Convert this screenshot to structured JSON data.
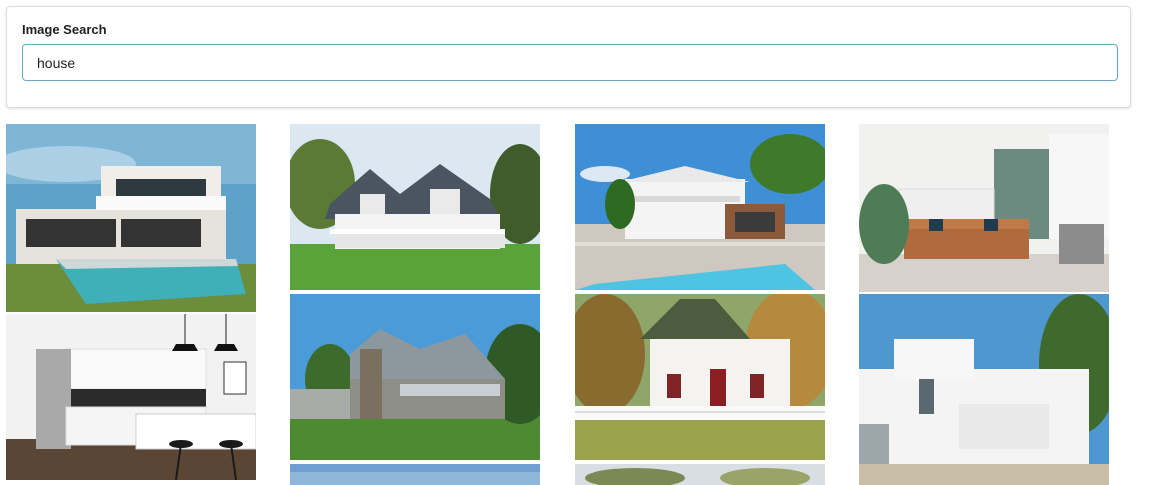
{
  "search": {
    "label": "Image Search",
    "value": "house"
  },
  "results": [
    {
      "subject": "modern-villa-with-pool"
    },
    {
      "subject": "white-kitchen"
    },
    {
      "subject": "victorian-house-on-lawn"
    },
    {
      "subject": "gray-stone-house"
    },
    {
      "subject": "tropical-house-with-pool"
    },
    {
      "subject": "white-cottage-red-door"
    },
    {
      "subject": "living-room-leather-sofa"
    },
    {
      "subject": "white-minimalist-house"
    },
    {
      "subject": "partial-sky-image"
    },
    {
      "subject": "partial-tree-image"
    }
  ],
  "colors": {
    "input_border": "#6aa8c2",
    "sky": "#4f98cf",
    "lawn": "#4f8f2f"
  }
}
